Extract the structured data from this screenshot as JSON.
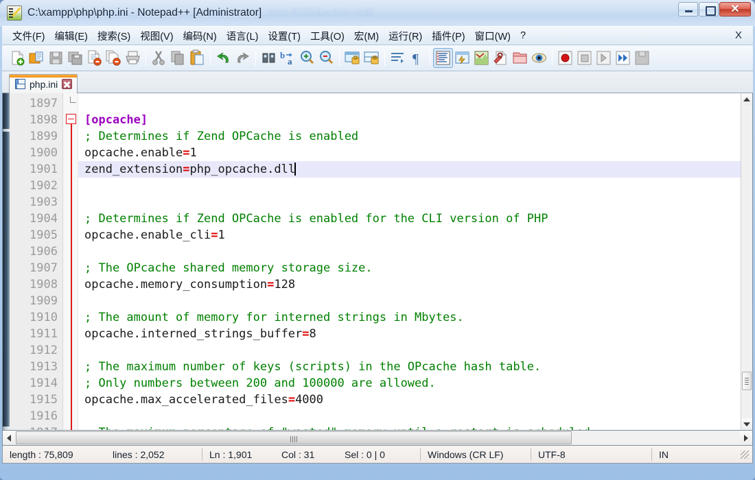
{
  "window": {
    "title": "C:\\xampp\\php\\php.ini - Notepad++ [Administrator]",
    "ghost_text": "post-8295&action=edit",
    "icon": "notepad-plus-plus-icon",
    "controls": {
      "minimize": "–",
      "maximize": "□",
      "close": "✕"
    }
  },
  "menubar": {
    "items": [
      {
        "label": "文件(F)",
        "name": "menu-file"
      },
      {
        "label": "编辑(E)",
        "name": "menu-edit"
      },
      {
        "label": "搜索(S)",
        "name": "menu-search"
      },
      {
        "label": "视图(V)",
        "name": "menu-view"
      },
      {
        "label": "编码(N)",
        "name": "menu-encoding"
      },
      {
        "label": "语言(L)",
        "name": "menu-language"
      },
      {
        "label": "设置(T)",
        "name": "menu-settings"
      },
      {
        "label": "工具(O)",
        "name": "menu-tools"
      },
      {
        "label": "宏(M)",
        "name": "menu-macro"
      },
      {
        "label": "运行(R)",
        "name": "menu-run"
      },
      {
        "label": "插件(P)",
        "name": "menu-plugins"
      },
      {
        "label": "窗口(W)",
        "name": "menu-window"
      },
      {
        "label": "?",
        "name": "menu-help"
      }
    ],
    "close_doc_label": "X"
  },
  "toolbar": {
    "icons": [
      "new-file-icon",
      "open-file-icon",
      "save-icon",
      "save-all-icon",
      "close-file-icon",
      "close-all-icon",
      "print-icon",
      "cut-icon",
      "copy-icon",
      "paste-icon",
      "undo-icon",
      "redo-icon",
      "find-icon",
      "replace-icon",
      "zoom-in-icon",
      "zoom-out-icon",
      "sync-vertical-icon",
      "sync-horizontal-icon",
      "word-wrap-icon",
      "show-all-chars-icon",
      "indent-guide-icon",
      "user-defined-dialog-icon",
      "document-map-icon",
      "function-list-icon",
      "folder-as-workspace-icon",
      "preview-icon",
      "record-macro-icon",
      "stop-record-icon",
      "playback-icon",
      "run-multiple-icon",
      "save-macro-icon"
    ]
  },
  "tabs": [
    {
      "label": "php.ini",
      "icon": "saved-floppy-icon",
      "close": "close-tab-icon",
      "active": true
    }
  ],
  "editor": {
    "first_line": 1897,
    "current_line": 1901,
    "fold_marker_line": 1898,
    "colors": {
      "comment": "#008000",
      "section": "#9b00c0",
      "equals": "#e00000",
      "text": "#1a1a1a",
      "current_line_bg": "#e8e8fb",
      "gutter_bg": "#ededed",
      "gutter_fg": "#9b9b9b",
      "fold_marker": "#e01919"
    },
    "lines": [
      {
        "no": 1897,
        "parts": []
      },
      {
        "no": 1898,
        "parts": [
          {
            "t": "sec",
            "s": "[opcache]"
          }
        ]
      },
      {
        "no": 1899,
        "parts": [
          {
            "t": "cmt",
            "s": "; Determines if Zend OPCache is enabled"
          }
        ]
      },
      {
        "no": 1900,
        "parts": [
          {
            "t": "key",
            "s": "opcache.enable"
          },
          {
            "t": "eq",
            "s": "="
          },
          {
            "t": "val",
            "s": "1"
          }
        ]
      },
      {
        "no": 1901,
        "parts": [
          {
            "t": "key",
            "s": "zend_extension"
          },
          {
            "t": "eq",
            "s": "="
          },
          {
            "t": "val",
            "s": "php_opcache.dll"
          }
        ]
      },
      {
        "no": 1902,
        "parts": []
      },
      {
        "no": 1903,
        "parts": []
      },
      {
        "no": 1904,
        "parts": [
          {
            "t": "cmt",
            "s": "; Determines if Zend OPCache is enabled for the CLI version of PHP"
          }
        ]
      },
      {
        "no": 1905,
        "parts": [
          {
            "t": "key",
            "s": "opcache.enable_cli"
          },
          {
            "t": "eq",
            "s": "="
          },
          {
            "t": "val",
            "s": "1"
          }
        ]
      },
      {
        "no": 1906,
        "parts": []
      },
      {
        "no": 1907,
        "parts": [
          {
            "t": "cmt",
            "s": "; The OPcache shared memory storage size."
          }
        ]
      },
      {
        "no": 1908,
        "parts": [
          {
            "t": "key",
            "s": "opcache.memory_consumption"
          },
          {
            "t": "eq",
            "s": "="
          },
          {
            "t": "val",
            "s": "128"
          }
        ]
      },
      {
        "no": 1909,
        "parts": []
      },
      {
        "no": 1910,
        "parts": [
          {
            "t": "cmt",
            "s": "; The amount of memory for interned strings in Mbytes."
          }
        ]
      },
      {
        "no": 1911,
        "parts": [
          {
            "t": "key",
            "s": "opcache.interned_strings_buffer"
          },
          {
            "t": "eq",
            "s": "="
          },
          {
            "t": "val",
            "s": "8"
          }
        ]
      },
      {
        "no": 1912,
        "parts": []
      },
      {
        "no": 1913,
        "parts": [
          {
            "t": "cmt",
            "s": "; The maximum number of keys (scripts) in the OPcache hash table."
          }
        ]
      },
      {
        "no": 1914,
        "parts": [
          {
            "t": "cmt",
            "s": "; Only numbers between 200 and 100000 are allowed."
          }
        ]
      },
      {
        "no": 1915,
        "parts": [
          {
            "t": "key",
            "s": "opcache.max_accelerated_files"
          },
          {
            "t": "eq",
            "s": "="
          },
          {
            "t": "val",
            "s": "4000"
          }
        ]
      },
      {
        "no": 1916,
        "parts": []
      },
      {
        "no": 1917,
        "parts": [
          {
            "t": "cmt",
            "s": "; The maximum percentage of \"wasted\" memory until a restart is scheduled."
          }
        ]
      }
    ]
  },
  "statusbar": {
    "length": "length : 75,809",
    "lines": "lines : 2,052",
    "ln": "Ln : 1,901",
    "col": "Col : 31",
    "sel": "Sel : 0 | 0",
    "eol": "Windows (CR LF)",
    "encoding": "UTF-8",
    "insert_mode": "IN"
  }
}
